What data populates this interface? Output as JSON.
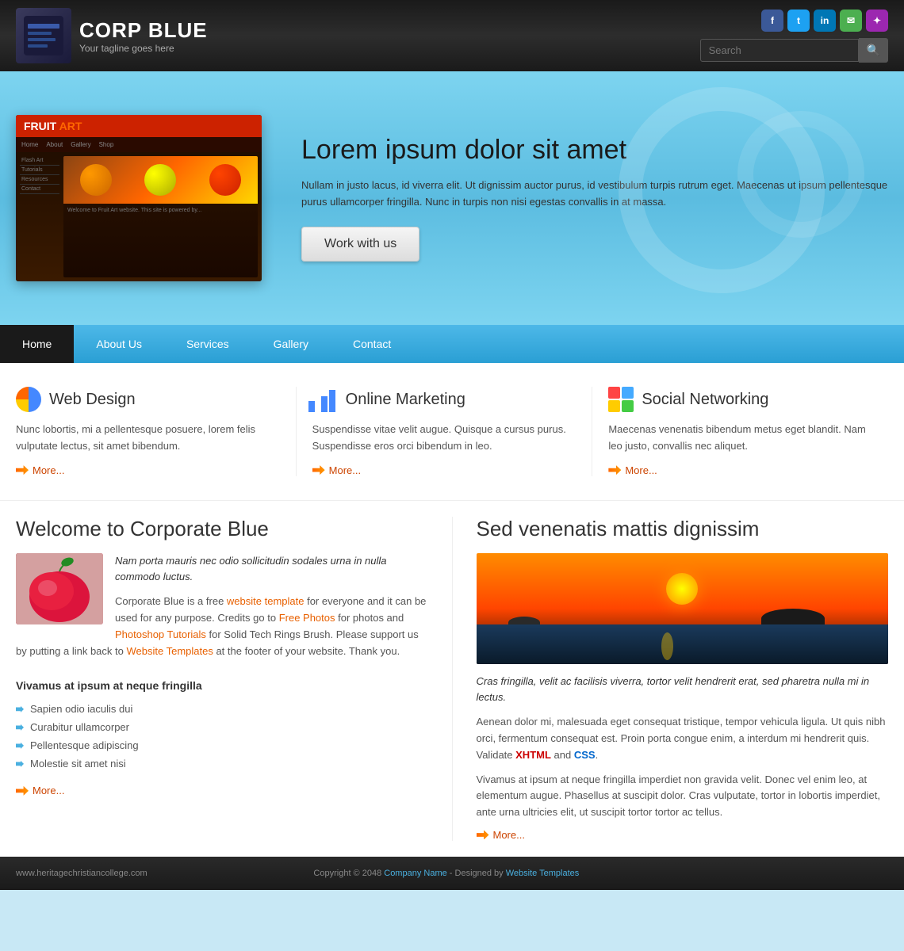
{
  "header": {
    "logo_title": "CORP BLUE",
    "logo_tagline": "Your tagline goes here",
    "search_placeholder": "Search",
    "search_btn_label": "🔍",
    "social": [
      {
        "name": "Facebook",
        "label": "f",
        "class": "si-fb"
      },
      {
        "name": "Twitter",
        "label": "t",
        "class": "si-tw"
      },
      {
        "name": "LinkedIn",
        "label": "in",
        "class": "si-li"
      },
      {
        "name": "Message",
        "label": "✉",
        "class": "si-msg"
      },
      {
        "name": "RSS",
        "label": "✦",
        "class": "si-rss"
      }
    ]
  },
  "hero": {
    "title": "Lorem ipsum dolor sit amet",
    "description": "Nullam in justo lacus, id viverra elit. Ut dignissim auctor purus, id vestibulum turpis rutrum eget. Maecenas ut ipsum pellentesque purus ullamcorper fringilla. Nunc in turpis non nisi egestas convallis in at massa.",
    "cta_label": "Work with us"
  },
  "nav": {
    "items": [
      {
        "label": "Home",
        "active": true
      },
      {
        "label": "About Us",
        "active": false
      },
      {
        "label": "Services",
        "active": false
      },
      {
        "label": "Gallery",
        "active": false
      },
      {
        "label": "Contact",
        "active": false
      }
    ]
  },
  "features": [
    {
      "icon": "webdesign",
      "title": "Web Design",
      "text": "Nunc lobortis, mi a pellentesque posuere, lorem felis vulputate lectus, sit amet bibendum.",
      "more": "More..."
    },
    {
      "icon": "marketing",
      "title": "Online Marketing",
      "text": "Suspendisse vitae velit augue. Quisque a cursus purus. Suspendisse eros orci bibendum in leo.",
      "more": "More..."
    },
    {
      "icon": "social",
      "title": "Social Networking",
      "text": "Maecenas venenatis bibendum metus eget blandit. Nam leo justo, convallis nec aliquet.",
      "more": "More..."
    }
  ],
  "welcome": {
    "title": "Welcome to Corporate Blue",
    "italic_text": "Nam porta mauris nec odio sollicitudin sodales urna in nulla commodo luctus.",
    "body_p1_before": "Corporate Blue is a free ",
    "body_p1_link": "website template",
    "body_p1_after": " for everyone and it can be used for any purpose. Credits go to ",
    "body_p1_link2": "Free Photos",
    "body_p1_after2": " for photos and ",
    "body_p1_link3": "Photoshop Tutorials",
    "body_p1_after3": " for Solid Tech Rings Brush. Please support us by putting a link back to ",
    "body_p1_link4": "Website Templates",
    "body_p1_after4": " at the footer of your website. Thank you.",
    "subsection_title": "Vivamus at ipsum at neque fringilla",
    "bullets": [
      "Sapien odio iaculis dui",
      "Curabitur ullamcorper",
      "Pellentesque adipiscing",
      "Molestie sit amet nisi"
    ],
    "more": "More..."
  },
  "venenatis": {
    "title": "Sed venenatis mattis dignissim",
    "italic_text": "Cras fringilla, velit ac facilisis viverra, tortor velit hendrerit erat, sed pharetra nulla mi in lectus.",
    "body_p1": "Aenean dolor mi, malesuada eget consequat tristique, tempor vehicula ligula. Ut quis nibh orci, fermentum consequat est. Proin porta congue enim, a interdum mi hendrerit quis. Validate ",
    "xhtml_label": "XHTML",
    "and_label": " and ",
    "css_label": "CSS",
    "period": ".",
    "body_p2": "Vivamus at ipsum at neque fringilla imperdiet non gravida velit. Donec vel enim leo, at elementum augue. Phasellus at suscipit dolor. Cras vulputate, tortor in lobortis imperdiet, ante urna ultricies elit, ut suscipit tortor tortor ac tellus.",
    "more": "More..."
  },
  "footer": {
    "left_text": "www.heritagechristiancollege.com",
    "copyright": "Copyright © 2048 ",
    "company_name": "Company Name",
    "designed_by": " - Designed by ",
    "website_templates": "Website Templates"
  }
}
